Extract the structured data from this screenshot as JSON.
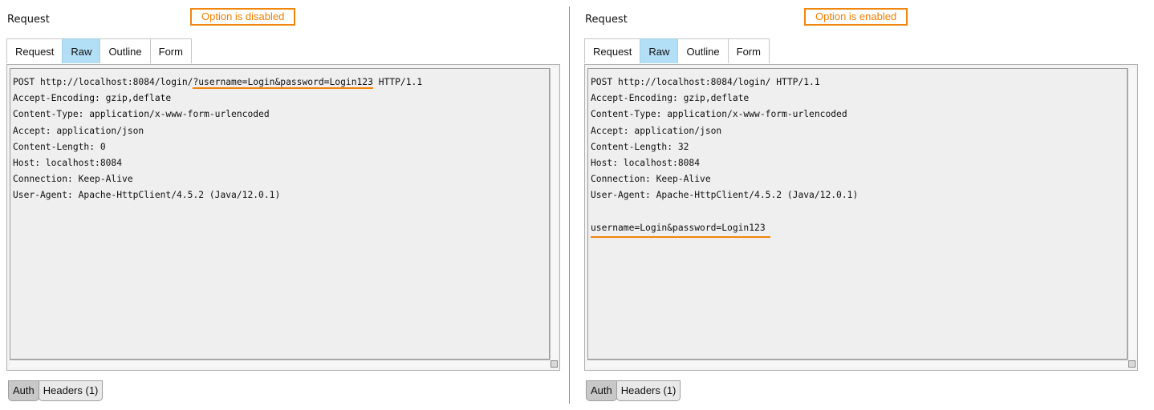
{
  "left": {
    "title": "Request",
    "note": "Option is disabled",
    "tabs": [
      "Request",
      "Raw",
      "Outline",
      "Form"
    ],
    "active_tab": "Raw",
    "raw": {
      "line1_prefix": "POST http://localhost:8084/login/",
      "line1_query": "?username=Login&password=Login123",
      "line1_suffix": " HTTP/1.1",
      "lines": [
        "Accept-Encoding: gzip,deflate",
        "Content-Type: application/x-www-form-urlencoded",
        "Accept: application/json",
        "Content-Length: 0",
        "Host: localhost:8084",
        "Connection: Keep-Alive",
        "User-Agent: Apache-HttpClient/4.5.2 (Java/12.0.1)"
      ]
    },
    "bottom_tabs": [
      "Auth",
      "Headers (1)"
    ]
  },
  "right": {
    "title": "Request",
    "note": "Option is enabled",
    "tabs": [
      "Request",
      "Raw",
      "Outline",
      "Form"
    ],
    "active_tab": "Raw",
    "raw": {
      "lines": [
        "POST http://localhost:8084/login/ HTTP/1.1",
        "Accept-Encoding: gzip,deflate",
        "Content-Type: application/x-www-form-urlencoded",
        "Accept: application/json",
        "Content-Length: 32",
        "Host: localhost:8084",
        "Connection: Keep-Alive",
        "User-Agent: Apache-HttpClient/4.5.2 (Java/12.0.1)"
      ],
      "body": "username=Login&password=Login123"
    },
    "bottom_tabs": [
      "Auth",
      "Headers (1)"
    ]
  },
  "colors": {
    "highlight": "#f0860c",
    "active_tab": "#b2dff5"
  }
}
